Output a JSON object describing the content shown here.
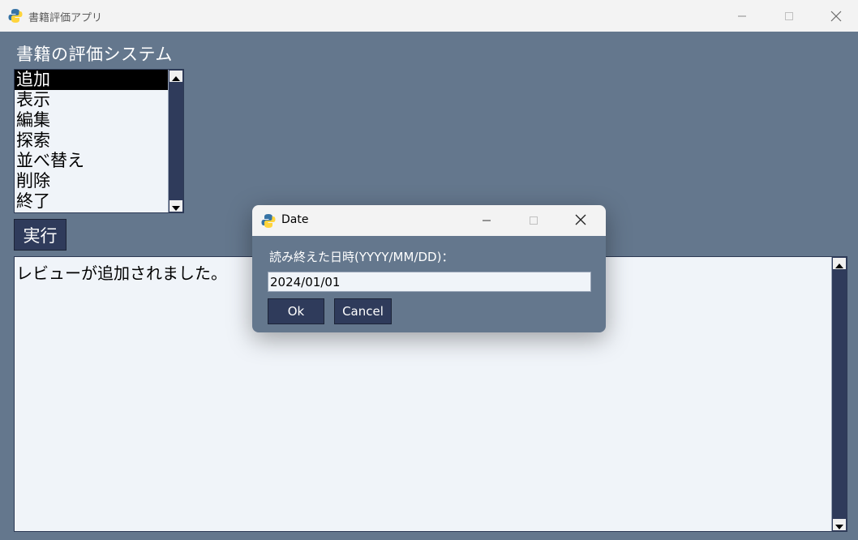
{
  "main_window": {
    "title": "書籍評価アプリ",
    "heading": "書籍の評価システム",
    "menu": {
      "items": [
        "追加",
        "表示",
        "編集",
        "探索",
        "並べ替え",
        "削除",
        "終了"
      ],
      "selected_index": 0
    },
    "run_label": "実行",
    "output_text": "レビューが追加されました。"
  },
  "dialog": {
    "title": "Date",
    "prompt": "読み終えた日時(YYYY/MM/DD)：",
    "input_value": "2024/01/01",
    "ok_label": "Ok",
    "cancel_label": "Cancel"
  },
  "colors": {
    "window_bg": "#64778d",
    "titlebar_bg": "#f3f3f3",
    "button_bg": "#2f3b5b",
    "field_bg": "#f0f4f9"
  },
  "icons": [
    "python-icon",
    "minimize-icon",
    "maximize-icon",
    "close-icon",
    "scroll-up-icon",
    "scroll-down-icon"
  ]
}
